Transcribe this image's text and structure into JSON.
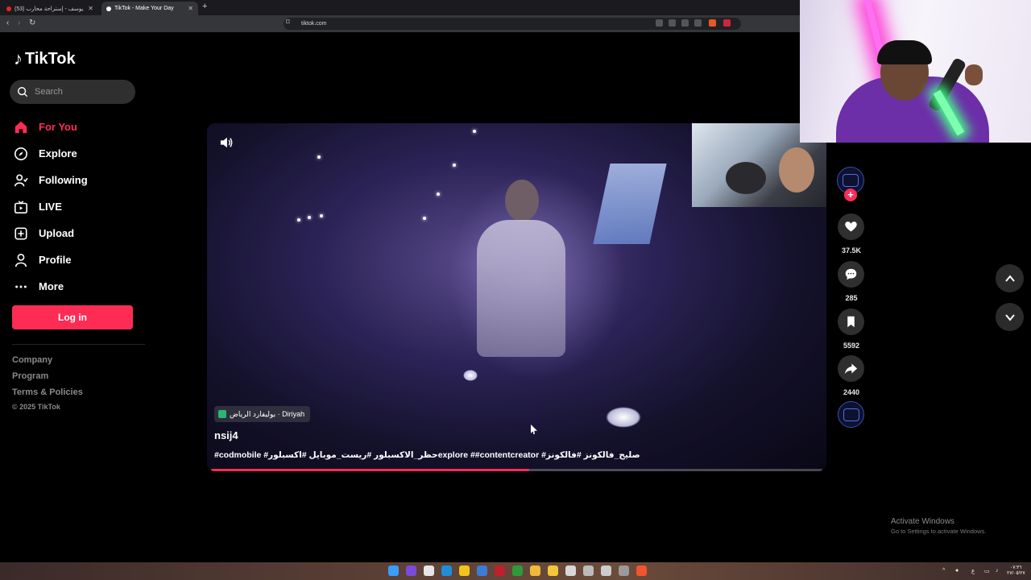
{
  "browser": {
    "tabs": [
      {
        "label": "(53) عايش يوسف - إستراحة محارب - ..."
      },
      {
        "label": "TikTok - Make Your Day"
      }
    ],
    "url": "tiktok.com"
  },
  "sidebar": {
    "logo": "TikTok",
    "search_placeholder": "Search",
    "nav": [
      {
        "label": "For You",
        "icon": "home-icon",
        "active": true
      },
      {
        "label": "Explore",
        "icon": "compass-icon"
      },
      {
        "label": "Following",
        "icon": "user-follow-icon"
      },
      {
        "label": "LIVE",
        "icon": "live-icon"
      },
      {
        "label": "Upload",
        "icon": "plus-box-icon"
      },
      {
        "label": "Profile",
        "icon": "person-icon"
      },
      {
        "label": "More",
        "icon": "more-dots-icon"
      }
    ],
    "login_label": "Log in",
    "footer_links": [
      "Company",
      "Program",
      "Terms & Policies"
    ],
    "copyright": "© 2025 TikTok"
  },
  "video": {
    "location": "بوليفارد الرياض · Diriyah",
    "author": "nsij4",
    "caption": "#codmobile #حظر_الاكسبلور #ريست_موبايل #اكسبلورexplore ##contentcreator #صليح_فالكونز #فالكونز",
    "progress": 0.52
  },
  "actions": {
    "likes": "37.5K",
    "comments": "285",
    "saves": "5592",
    "shares": "2440"
  },
  "watermark": {
    "title": "Activate Windows",
    "subtitle": "Go to Settings to activate Windows."
  },
  "taskbar": {
    "lang": "ع",
    "time": "٠٧:٣٦",
    "date": "٢٧/٠٥/٢٧"
  },
  "colors": {
    "accent": "#fe2c55",
    "background": "#000000"
  }
}
